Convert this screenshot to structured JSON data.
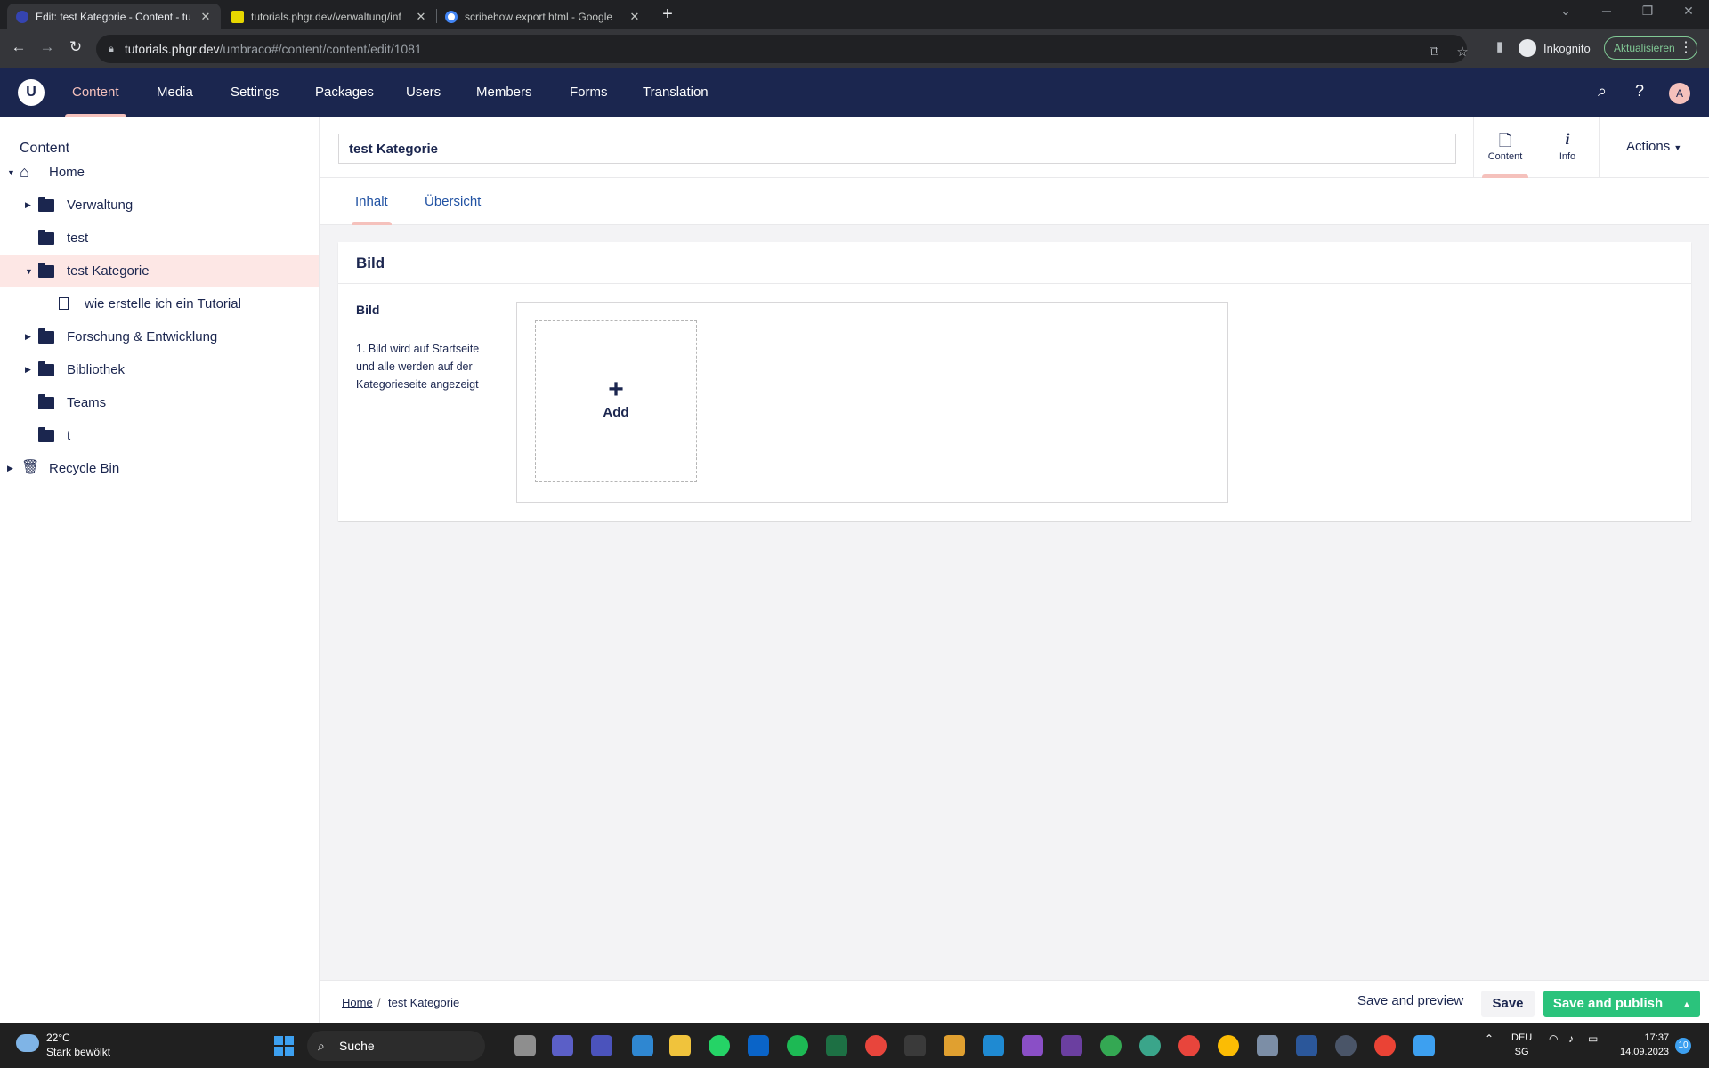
{
  "browser": {
    "tabs": [
      {
        "title": "Edit: test Kategorie - Content - tu",
        "icon": "umbraco-favicon-icon",
        "active": true
      },
      {
        "title": "tutorials.phgr.dev/verwaltung/inf",
        "icon": "ph-favicon-icon",
        "active": false
      },
      {
        "title": "scribehow export html - Google",
        "icon": "google-favicon-icon",
        "active": false
      }
    ],
    "url_host": "tutorials.phgr.dev",
    "url_path": "/umbraco#/content/content/edit/1081",
    "incognito_label": "Inkognito",
    "update_label": "Aktualisieren"
  },
  "header": {
    "logo": "U",
    "sections": [
      "Content",
      "Media",
      "Settings",
      "Packages",
      "Users",
      "Members",
      "Forms",
      "Translation"
    ],
    "active_section": "Content",
    "avatar_initial": "A"
  },
  "tree": {
    "title": "Content",
    "nodes": [
      {
        "label": "Home",
        "icon": "home-icon",
        "expanded": true
      },
      {
        "label": "Verwaltung",
        "icon": "folder-icon",
        "expandable": true
      },
      {
        "label": "test",
        "icon": "folder-icon"
      },
      {
        "label": "test Kategorie",
        "icon": "folder-icon",
        "expanded": true,
        "selected": true
      },
      {
        "label": "wie erstelle ich ein Tutorial",
        "icon": "document-icon"
      },
      {
        "label": "Forschung & Entwicklung",
        "icon": "folder-icon",
        "expandable": true
      },
      {
        "label": "Bibliothek",
        "icon": "folder-icon",
        "expandable": true
      },
      {
        "label": "Teams",
        "icon": "folder-icon"
      },
      {
        "label": "t",
        "icon": "folder-icon"
      },
      {
        "label": "Recycle Bin",
        "icon": "trash-icon",
        "expandable": true
      }
    ]
  },
  "editor": {
    "name_value": "test Kategorie",
    "apps": [
      {
        "label": "Content",
        "icon": "document-icon",
        "active": true
      },
      {
        "label": "Info",
        "icon": "info-icon",
        "active": false
      }
    ],
    "actions_label": "Actions",
    "tabs": [
      "Inhalt",
      "Übersicht"
    ],
    "active_tab": "Inhalt",
    "group_title": "Bild",
    "property": {
      "label": "Bild",
      "description": "1. Bild wird auf Startseite und alle werden auf der Kategorieseite angezeigt",
      "add_label": "Add"
    }
  },
  "footer": {
    "breadcrumb_home": "Home",
    "breadcrumb_current": "test Kategorie",
    "save_preview_label": "Save and preview",
    "save_label": "Save",
    "publish_label": "Save and publish"
  },
  "taskbar": {
    "temperature": "22°C",
    "weather": "Stark bewölkt",
    "search_label": "Suche",
    "lang_1": "DEU",
    "lang_2": "SG",
    "time": "17:37",
    "date": "14.09.2023",
    "notifications": "10"
  },
  "colors": {
    "header_bg": "#1b264f",
    "accent_pink": "#f5c1bc",
    "publish_green": "#2bc37c",
    "tab_link_blue": "#2152a3"
  }
}
